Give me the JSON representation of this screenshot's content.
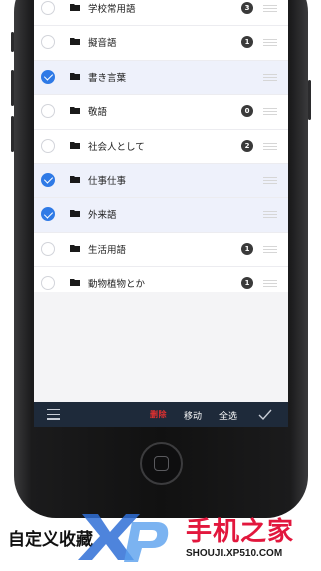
{
  "list": {
    "rows": [
      {
        "label": "学校常用語",
        "selected": false,
        "badge": "3"
      },
      {
        "label": "擬音語",
        "selected": false,
        "badge": "1"
      },
      {
        "label": "書き言葉",
        "selected": true,
        "badge": ""
      },
      {
        "label": "敬語",
        "selected": false,
        "badge": "0"
      },
      {
        "label": "社会人として",
        "selected": false,
        "badge": "2"
      },
      {
        "label": "仕事仕事",
        "selected": true,
        "badge": ""
      },
      {
        "label": "外来語",
        "selected": true,
        "badge": ""
      },
      {
        "label": "生活用語",
        "selected": false,
        "badge": "1"
      },
      {
        "label": "動物植物とか",
        "selected": false,
        "badge": "1"
      }
    ]
  },
  "toolbar": {
    "delete_label": "删除",
    "move_label": "移动",
    "select_all_label": "全选"
  },
  "caption": "自定义收藏",
  "watermark": {
    "brand": "手机之家",
    "url": "SHOUJI.XP510.COM"
  },
  "colors": {
    "accent": "#2f7ae6",
    "toolbar": "#1e2a3a",
    "delete": "#e03030",
    "watermark": "#e2173d"
  }
}
